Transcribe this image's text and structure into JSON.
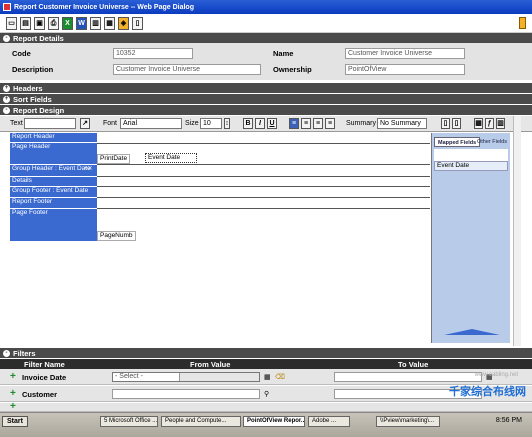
{
  "window": {
    "title": "Report Customer Invoice Universe -- Web Page Dialog"
  },
  "toolbar": {
    "icons": [
      "new-icon",
      "open-icon",
      "save-icon",
      "print-icon",
      "excel-icon",
      "word-icon",
      "pdf-icon",
      "export-icon",
      "refresh-icon",
      "exit-icon"
    ]
  },
  "sections": {
    "report_details": "Report Details",
    "headers": "Headers",
    "sort_fields": "Sort Fields",
    "report_design": "Report Design",
    "filters": "Filters"
  },
  "details": {
    "code_label": "Code",
    "code_value": "10352",
    "name_label": "Name",
    "name_value": "Customer Invoice Universe",
    "description_label": "Description",
    "description_value": "Customer Invoice Universe",
    "ownership_label": "Ownership",
    "ownership_value": "PointOfView"
  },
  "design_toolbar": {
    "text_label": "Text",
    "font_label": "Font",
    "font_value": "Arial",
    "size_label": "Size",
    "size_value": "10",
    "bold": "B",
    "italic": "I",
    "underline": "U",
    "summary_label": "Summary",
    "summary_value": "No Summary"
  },
  "bands": [
    "Report Header",
    "Page Header",
    "Group Header : Event Date",
    "Details",
    "Group Footer : Event Date",
    "Report Footer",
    "Page Footer"
  ],
  "canvas_fields": {
    "print_date": "PrintDate",
    "event_date": "Event Date",
    "page_numb": "PageNumb"
  },
  "right_panel": {
    "tab_mapped": "Mapped Fields",
    "tab_other": "Other Fields",
    "item": "Event Date"
  },
  "filters": {
    "col_name": "Filter Name",
    "col_from": "From Value",
    "col_to": "To Value",
    "rows": [
      {
        "name": "Invoice Date",
        "from": "- Select -"
      },
      {
        "name": "Customer",
        "from": ""
      },
      {
        "name": "",
        "from": ""
      }
    ]
  },
  "taskbar": {
    "start": "Start",
    "tasks": [
      "5 Microsoft Office ...",
      "People and Compute...",
      "PointOfView Repor...",
      "Adobe ...",
      "\\\\Pview\\marketing\\..."
    ],
    "clock": "8:56 PM"
  },
  "watermark": "千家综合布线网",
  "colors": {
    "title_bar": "#0a3bbf",
    "band": "#3a6ad0",
    "panel": "#b8ccea",
    "section": "#4a4a4a"
  }
}
